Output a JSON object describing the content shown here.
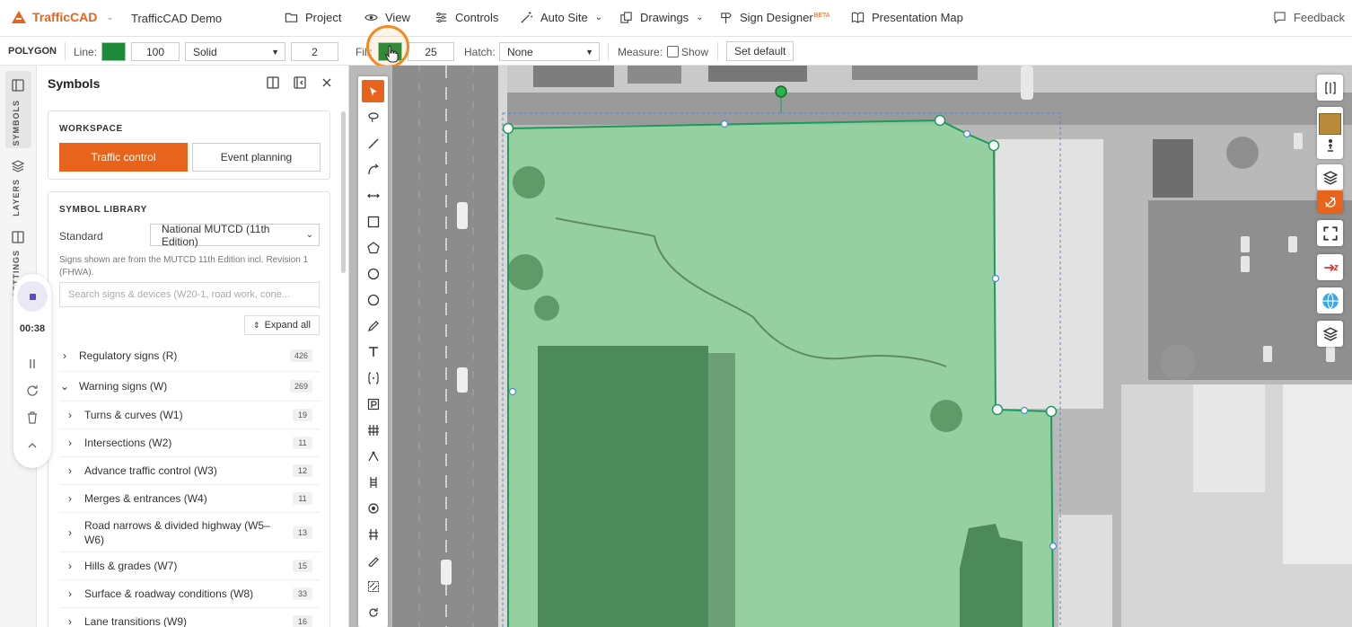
{
  "app": {
    "name": "TrafficCAD",
    "project": "TrafficCAD Demo"
  },
  "menu": [
    {
      "label": "Project",
      "icon": "folder-icon"
    },
    {
      "label": "View",
      "icon": "eye-icon"
    },
    {
      "label": "Controls",
      "icon": "sliders-icon"
    },
    {
      "label": "Auto Site",
      "icon": "magic-wand-icon",
      "caret": true
    },
    {
      "label": "Drawings",
      "icon": "drawings-icon",
      "caret": true
    },
    {
      "label": "Sign Designer",
      "icon": "sign-icon",
      "badge": "BETA"
    },
    {
      "label": "Presentation Map",
      "icon": "book-icon"
    }
  ],
  "feedback": "Feedback",
  "toolbar": {
    "title": "POLYGON",
    "line_label": "Line:",
    "line_color": "#1e8a3c",
    "line_opacity": "100",
    "line_style": "Solid",
    "line_width": "2",
    "fill_label": "Fill:",
    "fill_color": "#1e8a3c",
    "fill_opacity": "25",
    "hatch_label": "Hatch:",
    "hatch_value": "None",
    "measure_label": "Measure:",
    "show_label": "Show",
    "set_default": "Set default"
  },
  "rail": {
    "symbols": "SYMBOLS",
    "layers": "LAYERS",
    "settings": "SETTINGS"
  },
  "recorder": {
    "time": "00:38"
  },
  "panel": {
    "title": "Symbols",
    "workspace": {
      "title": "WORKSPACE",
      "options": [
        "Traffic control",
        "Event planning"
      ],
      "active": "Traffic control"
    },
    "library": {
      "title": "SYMBOL LIBRARY",
      "standard_label": "Standard",
      "standard_value": "National MUTCD (11th Edition)",
      "note": "Signs shown are from the MUTCD 11th Edition incl. Revision 1 (FHWA).",
      "search_placeholder": "Search signs & devices (W20-1, road work, cone...",
      "expand_all": "Expand all"
    },
    "categories": [
      {
        "label": "Regulatory signs (R)",
        "count": "426",
        "expanded": false,
        "level": 0
      },
      {
        "label": "Warning signs (W)",
        "count": "269",
        "expanded": true,
        "level": 0
      },
      {
        "label": "Turns & curves (W1)",
        "count": "19",
        "level": 1
      },
      {
        "label": "Intersections (W2)",
        "count": "11",
        "level": 1
      },
      {
        "label": "Advance traffic control (W3)",
        "count": "12",
        "level": 1
      },
      {
        "label": "Merges & entrances (W4)",
        "count": "11",
        "level": 1
      },
      {
        "label": "Road narrows & divided highway (W5–W6)",
        "count": "13",
        "level": 1
      },
      {
        "label": "Hills & grades (W7)",
        "count": "15",
        "level": 1
      },
      {
        "label": "Surface & roadway conditions (W8)",
        "count": "33",
        "level": 1
      },
      {
        "label": "Lane transitions (W9)",
        "count": "16",
        "level": 1
      }
    ]
  },
  "colors": {
    "accent": "#e8631c",
    "polygon": "#1e8a3c"
  }
}
